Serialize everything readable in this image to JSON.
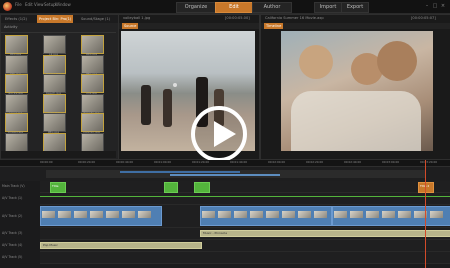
{
  "app": {
    "menu": [
      "File",
      "Edit",
      "View",
      "Setup",
      "Window"
    ],
    "modes": [
      "Organize",
      "Edit",
      "Author"
    ],
    "active_mode": "Edit",
    "right_tabs": [
      "Import",
      "Export"
    ],
    "window_controls": [
      "minimize-icon",
      "maximize-icon",
      "close-icon"
    ]
  },
  "library": {
    "tabs": [
      "Effects (1/2)",
      "Project Bin: Pro(1)",
      "Sound/Stage (1)"
    ],
    "active_tab": "Project Bin: Pro(1)",
    "folder_label": "Activity",
    "items": [
      "IMG.jpg",
      "ok.jpg",
      "IMG.jpg",
      "MG.jpg",
      "frame.jpg",
      "IMG.jpg",
      "gocity.jpg",
      "beach.jpg",
      "mg.jpg",
      "canal.jpg",
      "girls.jpg",
      "friends.jpg",
      "thread.jpg",
      "IMG.jpg",
      "zoomin.jpg",
      "sand.jpg",
      "",
      ""
    ]
  },
  "source_viewer": {
    "filename": "volleyball 1.jpg",
    "timecode": "[00:00:05.00]",
    "tab": "Source"
  },
  "program_viewer": {
    "filename": "California Summer 16 Movie.axp",
    "timecode": "[00:00:05:07]",
    "tab": "Timeline",
    "ruler": [
      "00:00:00",
      "00:01:00",
      "00:02:00",
      "00:03:00",
      "00:04:00",
      "00:05:00",
      "00:06:00",
      "00:07:00",
      "00:08:00"
    ]
  },
  "timeline": {
    "ruler": [
      "00:00:00",
      "00:00:20.00",
      "00:00:40.00",
      "00:01:00.00",
      "00:01:20.00",
      "00:01:40.00",
      "00:02:00.00",
      "00:02:20.00",
      "00:02:40.00",
      "00:03:00.00",
      "00:03:20.00"
    ],
    "tracks": [
      "Main Track (V)",
      "A/V Track (1)",
      "A/V Track (2)",
      "A/V Track (3)",
      "A/V Track (4)",
      "A/V Track (5)",
      "A/V Track (6)"
    ],
    "clip_labels": [
      "Title",
      "Title 2"
    ],
    "audio_labels": [
      "Music - Pinnacle",
      "Pop Music"
    ]
  },
  "overlay": {
    "play_button": "play-icon"
  },
  "colors": {
    "accent": "#c8782a",
    "video_clip": "#4f7fb3",
    "audio_clip": "#b7b48a",
    "marker": "#53b43c"
  }
}
